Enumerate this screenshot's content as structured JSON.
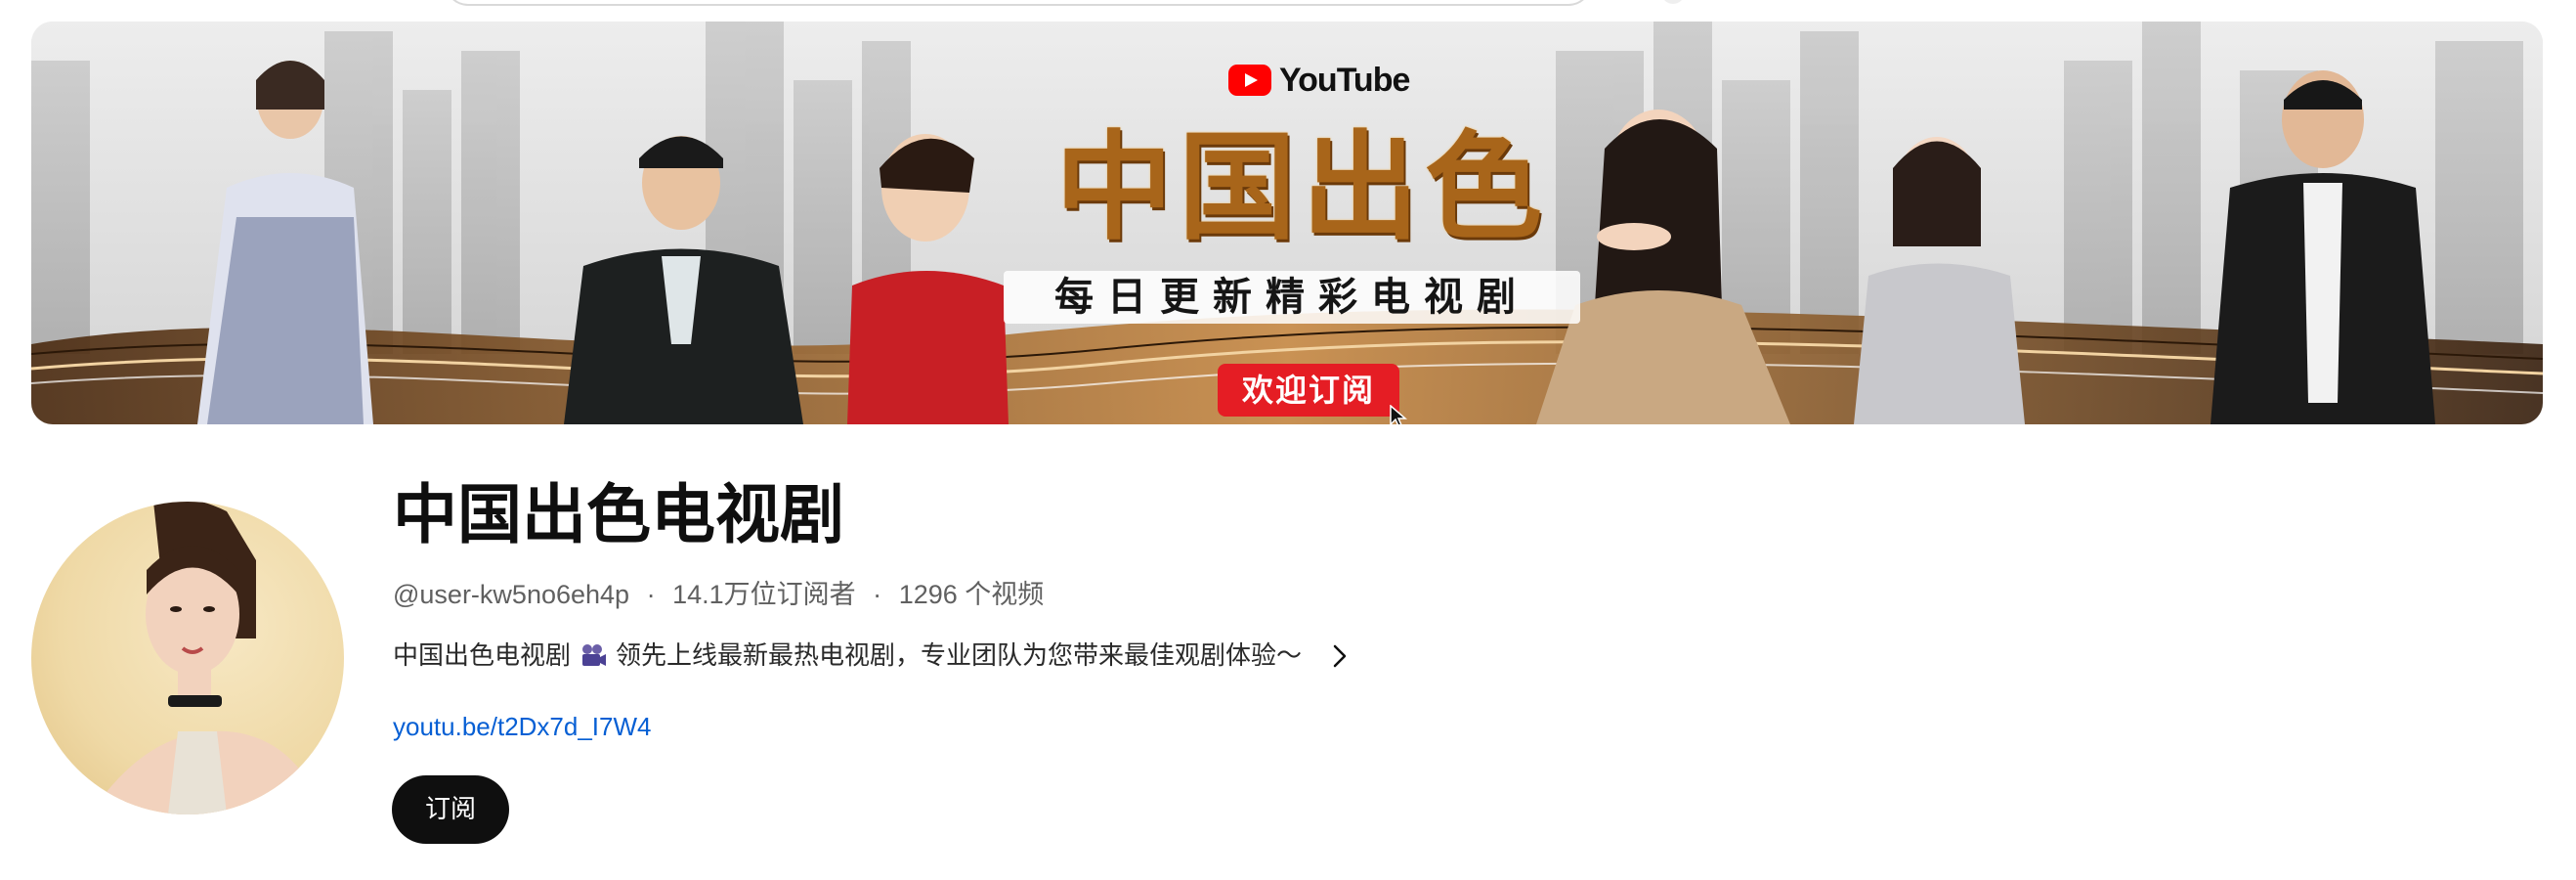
{
  "banner": {
    "brand": "YouTube",
    "title": "中国出色",
    "subtitle": "每日更新精彩电视剧",
    "cta_label": "欢迎订阅"
  },
  "channel": {
    "name": "中国出色电视剧",
    "handle": "@user-kw5no6eh4p",
    "separator": "·",
    "subscribers": "14.1万位订阅者",
    "videos": "1296 个视频",
    "description_start": "中国出色电视剧",
    "description_icon": "movie-camera-icon",
    "description_end": "领先上线最新最热电视剧，专业团队为您带来最佳观剧体验～",
    "link": "youtu.be/t2Dx7d_I7W4",
    "subscribe_label": "订阅"
  },
  "colors": {
    "subscribe_bg": "#0f0f0f",
    "link": "#065fd4",
    "cta_red": "#e51d24",
    "title_gold": "#a8651a"
  }
}
